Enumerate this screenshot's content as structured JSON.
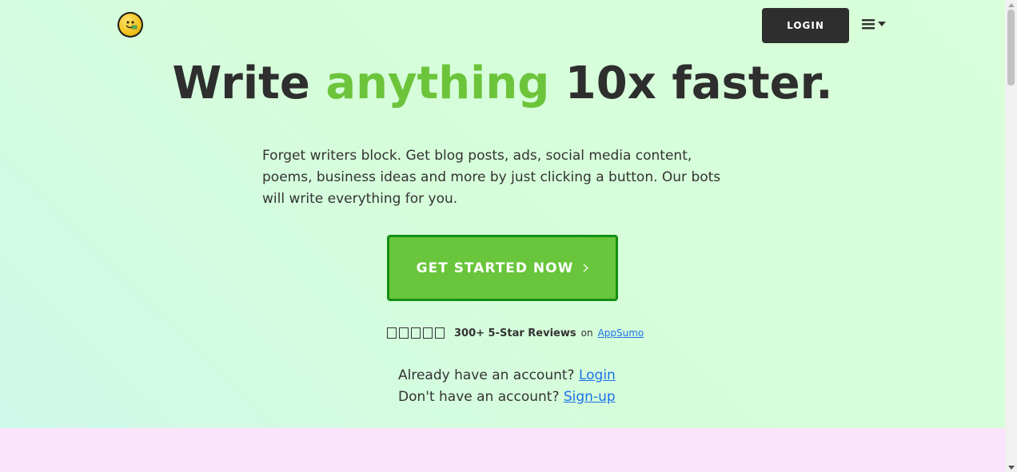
{
  "header": {
    "logo_alt": "money face logo",
    "login_label": "LOGIN",
    "menu_icon": "hamburger-icon"
  },
  "hero": {
    "headline_pre": "Write ",
    "headline_accent": "anything",
    "headline_post": " 10x faster.",
    "description": "Forget writers block. Get blog posts, ads, social media content, poems, business ideas and more by just clicking a button. Our bots will write everything for you.",
    "cta_label": "GET STARTED NOW",
    "cta_icon": "chevron-right-icon"
  },
  "reviews": {
    "stars": [
      "",
      "",
      "",
      "",
      ""
    ],
    "count_text": "300+ 5-Star Reviews",
    "on_text": "on",
    "source_link": "AppSumo"
  },
  "account": {
    "have_text": "Already have an account?",
    "login_link": "Login",
    "no_text": "Don't have an account?",
    "signup_link": "Sign-up"
  },
  "colors": {
    "accent_green": "#6cc43a",
    "cta_border": "#148f14",
    "dark_button": "#2e2e2e",
    "link": "#1a73e8",
    "hero_bg": "#d8ffd9",
    "next_section_bg": "#fbe3fc"
  }
}
